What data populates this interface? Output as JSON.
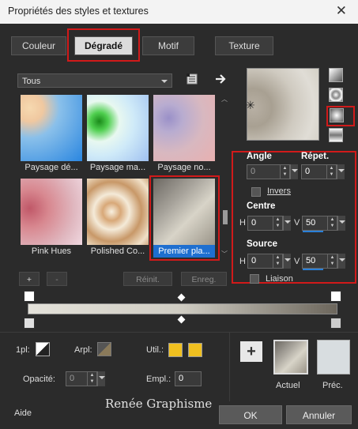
{
  "window": {
    "title": "Propriétés des styles et textures",
    "close": "✕"
  },
  "tabs": [
    {
      "label": "Couleur"
    },
    {
      "label": "Dégradé"
    },
    {
      "label": "Motif"
    },
    {
      "label": "Texture"
    }
  ],
  "category": {
    "selected": "Tous"
  },
  "gradients": [
    {
      "label": "Paysage dé..."
    },
    {
      "label": "Paysage ma..."
    },
    {
      "label": "Paysage no..."
    },
    {
      "label": "Pink Hues"
    },
    {
      "label": "Polished Co..."
    },
    {
      "label": "Premier pla..."
    }
  ],
  "list_buttons": {
    "add": "+",
    "remove": "-",
    "reset": "Réinit.",
    "save": "Enreg."
  },
  "params": {
    "angle_label": "Angle",
    "angle_value": "0",
    "repeat_label": "Répet.",
    "repeat_value": "0",
    "invert_label": "Invers",
    "center_label": "Centre",
    "center_h_label": "H",
    "center_h_value": "0",
    "center_v_label": "V",
    "center_v_value": "50",
    "source_label": "Source",
    "source_h_label": "H",
    "source_h_value": "0",
    "source_v_label": "V",
    "source_v_value": "50",
    "link_label": "Liaison"
  },
  "bottom": {
    "one_pl_label": "1pl:",
    "arpl_label": "Arpl:",
    "util_label": "Util.:",
    "opacity_label": "Opacité:",
    "opacity_value": "0",
    "empl_label": "Empl.:",
    "empl_value": "0",
    "current_label": "Actuel",
    "previous_label": "Préc.",
    "add": "+"
  },
  "watermark": "Renée Graphisme",
  "footer": {
    "help": "Aide",
    "ok": "OK",
    "cancel": "Annuler"
  },
  "colors": {
    "highlight": "#d11a1a",
    "selection": "#1e6fd0",
    "swatch_yellow": "#f0c020"
  }
}
